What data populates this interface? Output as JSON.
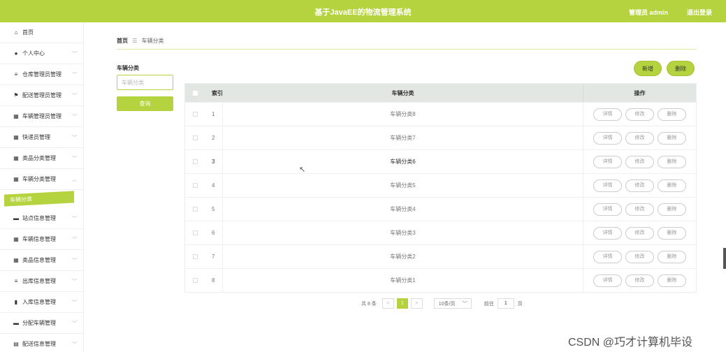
{
  "header": {
    "title": "基于JavaEE的物流管理系统",
    "user": "管理员 admin",
    "logout": "退出登录"
  },
  "sidebar": {
    "items": [
      {
        "label": "首页",
        "icon": "home-icon",
        "glyph": "⌂",
        "chevron": ""
      },
      {
        "label": "个人中心",
        "icon": "user-icon",
        "glyph": "●",
        "chevron": "﹀"
      },
      {
        "label": "仓库管理员管理",
        "icon": "list-icon",
        "glyph": "≡",
        "chevron": "﹀"
      },
      {
        "label": "配送管理员管理",
        "icon": "flag-icon",
        "glyph": "⚑",
        "chevron": "﹀"
      },
      {
        "label": "车辆管理员管理",
        "icon": "grid-icon",
        "glyph": "▦",
        "chevron": "﹀"
      },
      {
        "label": "快递员管理",
        "icon": "grid-icon",
        "glyph": "▦",
        "chevron": "﹀"
      },
      {
        "label": "类品分类管理",
        "icon": "grid-icon",
        "glyph": "▦",
        "chevron": "﹀"
      },
      {
        "label": "车辆分类管理",
        "icon": "grid-icon",
        "glyph": "▦",
        "chevron": "︿"
      }
    ],
    "active_sub": "车辆分类",
    "items_after": [
      {
        "label": "站点信息管理",
        "icon": "briefcase-icon",
        "glyph": "▬",
        "chevron": "﹀"
      },
      {
        "label": "车辆信息管理",
        "icon": "grid-icon",
        "glyph": "▦",
        "chevron": "﹀"
      },
      {
        "label": "类品信息管理",
        "icon": "grid-icon",
        "glyph": "▦",
        "chevron": "﹀"
      },
      {
        "label": "出库信息管理",
        "icon": "list-icon",
        "glyph": "≡",
        "chevron": "﹀"
      },
      {
        "label": "入库信息管理",
        "icon": "chart-icon",
        "glyph": "▮",
        "chevron": "﹀"
      },
      {
        "label": "分配车辆管理",
        "icon": "card-icon",
        "glyph": "▬",
        "chevron": "﹀"
      },
      {
        "label": "配送信息管理",
        "icon": "doc-icon",
        "glyph": "▤",
        "chevron": "﹀"
      }
    ]
  },
  "breadcrumb": {
    "home": "首页",
    "sep": "☰",
    "current": "车辆分类"
  },
  "search": {
    "label": "车辆分类",
    "placeholder": "车辆分类",
    "button": "查询"
  },
  "actions": {
    "add": "新增",
    "delete": "删除"
  },
  "table": {
    "headers": {
      "index": "索引",
      "name": "车辆分类",
      "ops": "操作"
    },
    "op_labels": {
      "detail": "详情",
      "edit": "修改",
      "delete": "删除"
    },
    "rows": [
      {
        "index": "1",
        "name": "车辆分类8"
      },
      {
        "index": "2",
        "name": "车辆分类7"
      },
      {
        "index": "3",
        "name": "车辆分类6"
      },
      {
        "index": "4",
        "name": "车辆分类5"
      },
      {
        "index": "5",
        "name": "车辆分类4"
      },
      {
        "index": "6",
        "name": "车辆分类3"
      },
      {
        "index": "7",
        "name": "车辆分类2"
      },
      {
        "index": "8",
        "name": "车辆分类1"
      }
    ]
  },
  "pager": {
    "total": "共 8 条",
    "prev": "<",
    "current": "1",
    "next": ">",
    "page_size": "10条/页",
    "goto_label": "前往",
    "goto_value": "1",
    "page_unit": "页"
  },
  "watermark": "CSDN @巧才计算机毕设",
  "colors": {
    "accent": "#b5d33f",
    "table_header": "#e2e7e3"
  }
}
